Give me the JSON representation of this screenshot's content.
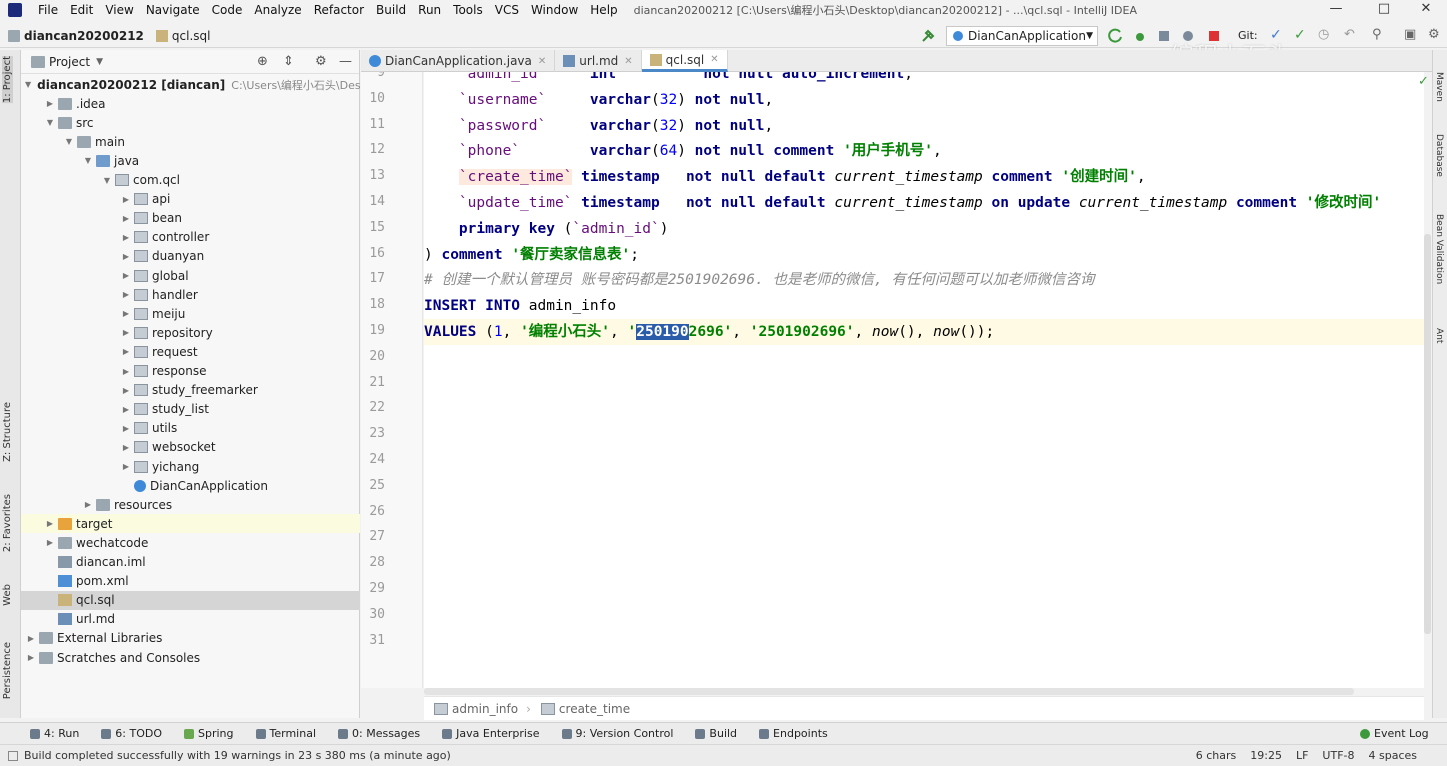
{
  "menu": [
    "File",
    "Edit",
    "View",
    "Navigate",
    "Code",
    "Analyze",
    "Refactor",
    "Build",
    "Run",
    "Tools",
    "VCS",
    "Window",
    "Help"
  ],
  "window_title": "diancan20200212 [C:\\Users\\编程小石头\\Desktop\\diancan20200212] - ...\\qcl.sql - IntelliJ IDEA",
  "nav": {
    "project": "diancan20200212",
    "file": "qcl.sql",
    "run_config": "DianCanApplication",
    "git_label": "Git:"
  },
  "watermark": "编程小石头",
  "project_panel": {
    "title": "Project",
    "tree": [
      {
        "label": "diancan20200212 [diancan]",
        "note": "C:\\Users\\编程小石头\\Desk",
        "depth": 0,
        "arrow": "open",
        "icon": "folder"
      },
      {
        "label": ".idea",
        "depth": 1,
        "arrow": "closed",
        "icon": "folder"
      },
      {
        "label": "src",
        "depth": 1,
        "arrow": "open",
        "icon": "folder"
      },
      {
        "label": "main",
        "depth": 2,
        "arrow": "open",
        "icon": "folder"
      },
      {
        "label": "java",
        "depth": 3,
        "arrow": "open",
        "icon": "folder-blue"
      },
      {
        "label": "com.qcl",
        "depth": 4,
        "arrow": "open",
        "icon": "pkg"
      },
      {
        "label": "api",
        "depth": 5,
        "arrow": "closed",
        "icon": "pkg"
      },
      {
        "label": "bean",
        "depth": 5,
        "arrow": "closed",
        "icon": "pkg"
      },
      {
        "label": "controller",
        "depth": 5,
        "arrow": "closed",
        "icon": "pkg"
      },
      {
        "label": "duanyan",
        "depth": 5,
        "arrow": "closed",
        "icon": "pkg"
      },
      {
        "label": "global",
        "depth": 5,
        "arrow": "closed",
        "icon": "pkg"
      },
      {
        "label": "handler",
        "depth": 5,
        "arrow": "closed",
        "icon": "pkg"
      },
      {
        "label": "meiju",
        "depth": 5,
        "arrow": "closed",
        "icon": "pkg"
      },
      {
        "label": "repository",
        "depth": 5,
        "arrow": "closed",
        "icon": "pkg"
      },
      {
        "label": "request",
        "depth": 5,
        "arrow": "closed",
        "icon": "pkg"
      },
      {
        "label": "response",
        "depth": 5,
        "arrow": "closed",
        "icon": "pkg"
      },
      {
        "label": "study_freemarker",
        "depth": 5,
        "arrow": "closed",
        "icon": "pkg"
      },
      {
        "label": "study_list",
        "depth": 5,
        "arrow": "closed",
        "icon": "pkg"
      },
      {
        "label": "utils",
        "depth": 5,
        "arrow": "closed",
        "icon": "pkg"
      },
      {
        "label": "websocket",
        "depth": 5,
        "arrow": "closed",
        "icon": "pkg"
      },
      {
        "label": "yichang",
        "depth": 5,
        "arrow": "closed",
        "icon": "pkg"
      },
      {
        "label": "DianCanApplication",
        "depth": 5,
        "arrow": "none",
        "icon": "class"
      },
      {
        "label": "resources",
        "depth": 3,
        "arrow": "closed",
        "icon": "folder"
      },
      {
        "label": "target",
        "depth": 1,
        "arrow": "closed",
        "icon": "folder-orange",
        "state": "hl"
      },
      {
        "label": "wechatcode",
        "depth": 1,
        "arrow": "closed",
        "icon": "folder"
      },
      {
        "label": "diancan.iml",
        "depth": 1,
        "arrow": "none",
        "icon": "iml"
      },
      {
        "label": "pom.xml",
        "depth": 1,
        "arrow": "none",
        "icon": "xml"
      },
      {
        "label": "qcl.sql",
        "depth": 1,
        "arrow": "none",
        "icon": "sql",
        "state": "sel"
      },
      {
        "label": "url.md",
        "depth": 1,
        "arrow": "none",
        "icon": "md"
      },
      {
        "label": "External Libraries",
        "depth": 0,
        "arrow": "closed",
        "icon": "folder"
      },
      {
        "label": "Scratches and Consoles",
        "depth": 0,
        "arrow": "closed",
        "icon": "folder"
      }
    ]
  },
  "tabs": [
    {
      "label": "DianCanApplication.java",
      "active": false
    },
    {
      "label": "url.md",
      "active": false
    },
    {
      "label": "qcl.sql",
      "active": true
    }
  ],
  "editor": {
    "lines": [
      {
        "n": "9",
        "html": "    <span class='col'>`admin_id`</span>     <span class='kw'>int</span>          <span class='kw'>not null auto_increment</span>,"
      },
      {
        "n": "10",
        "html": "    <span class='col'>`username`</span>     <span class='kw'>varchar</span>(<span style='color:#0000ff'>32</span>) <span class='kw'>not null</span>,"
      },
      {
        "n": "11",
        "html": "    <span class='col'>`password`</span>     <span class='kw'>varchar</span>(<span style='color:#0000ff'>32</span>) <span class='kw'>not null</span>,"
      },
      {
        "n": "12",
        "html": "    <span class='col'>`phone`</span>        <span class='kw'>varchar</span>(<span style='color:#0000ff'>64</span>) <span class='kw'>not null comment</span> <span class='str'>'用户手机号'</span>,"
      },
      {
        "n": "13",
        "html": "    <span class='col col-hl'>`create_time`</span> <span class='kw'>timestamp</span>   <span class='kw'>not null default</span> <span class='fn'>current_timestamp</span> <span class='kw'>comment</span> <span class='str'>'创建时间'</span>,"
      },
      {
        "n": "14",
        "html": "    <span class='col'>`update_time`</span> <span class='kw'>timestamp</span>   <span class='kw'>not null default</span> <span class='fn'>current_timestamp</span> <span class='kw'>on update</span> <span class='fn'>current_timestamp</span> <span class='kw'>comment</span> <span class='str'>'修改时间'</span>"
      },
      {
        "n": "15",
        "html": "    <span class='kw'>primary key</span> (<span class='col'>`admin_id`</span>)"
      },
      {
        "n": "16",
        "html": ") <span class='kw'>comment</span> <span class='str'>'餐厅卖家信息表'</span>;"
      },
      {
        "n": "17",
        "html": "<span class='cmt'># 创建一个默认管理员 账号密码都是2501902696. 也是老师的微信, 有任何问题可以加老师微信咨询</span>"
      },
      {
        "n": "18",
        "html": "<span class='kw'>INSERT INTO</span> admin_info"
      },
      {
        "n": "19",
        "html": "<span class='kw'>VALUES</span> (<span style='color:#0000ff'>1</span>, <span class='str'>'编程小石头'</span>, <span class='str'>'<span class='sel-text'>250190</span>2696'</span>, <span class='str'>'2501902696'</span>, <span class='fn'>now</span>(), <span class='fn'>now</span>());",
        "current": true
      },
      {
        "n": "20",
        "html": ""
      },
      {
        "n": "21",
        "html": ""
      },
      {
        "n": "22",
        "html": ""
      },
      {
        "n": "23",
        "html": ""
      },
      {
        "n": "24",
        "html": ""
      },
      {
        "n": "25",
        "html": ""
      },
      {
        "n": "26",
        "html": ""
      },
      {
        "n": "27",
        "html": ""
      },
      {
        "n": "28",
        "html": ""
      },
      {
        "n": "29",
        "html": ""
      },
      {
        "n": "30",
        "html": ""
      },
      {
        "n": "31",
        "html": ""
      }
    ],
    "breadcrumb": [
      "admin_info",
      "create_time"
    ]
  },
  "left_tool_tabs": [
    "1: Project",
    "Z: Structure",
    "2: Favorites",
    "Web",
    "Persistence"
  ],
  "right_tool_tabs": [
    "Maven",
    "Database",
    "Bean Validation",
    "Ant"
  ],
  "tool_windows": [
    "4: Run",
    "6: TODO",
    "Spring",
    "Terminal",
    "0: Messages",
    "Java Enterprise",
    "9: Version Control",
    "Build",
    "Endpoints"
  ],
  "event_log": "Event Log",
  "status": {
    "message": "Build completed successfully with 19 warnings in 23 s 380 ms (a minute ago)",
    "chars": "6 chars",
    "position": "19:25",
    "line_sep": "LF",
    "encoding": "UTF-8",
    "indent": "4 spaces"
  }
}
